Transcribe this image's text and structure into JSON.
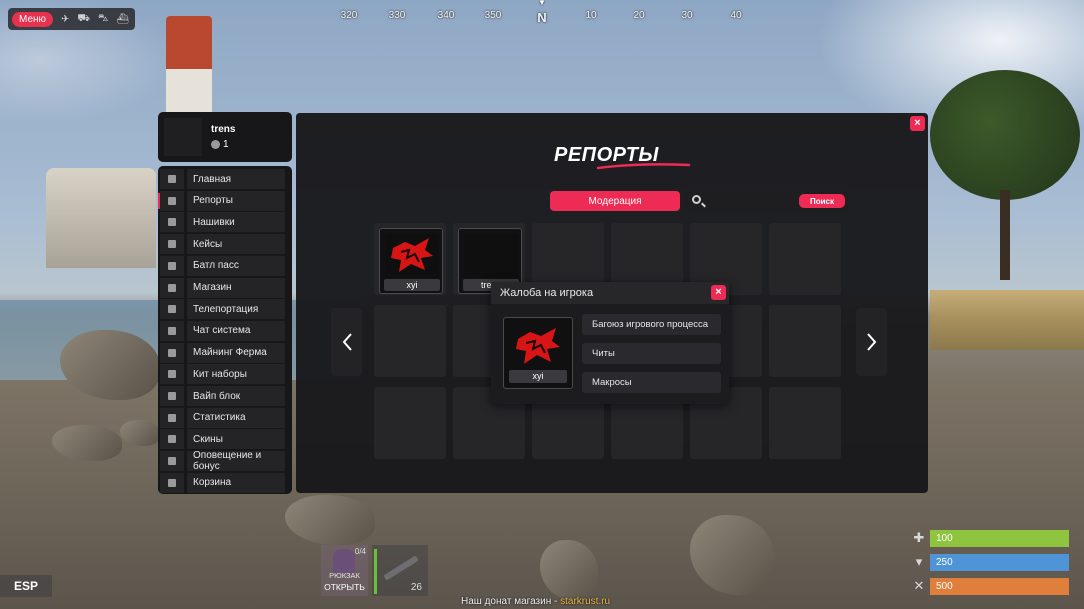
{
  "top_menu": {
    "menu_label": "Меню",
    "icons": [
      "plane-icon",
      "helicopter-icon",
      "tank-icon",
      "boat-icon"
    ]
  },
  "compass": {
    "ticks": [
      "320",
      "330",
      "340",
      "350",
      "N",
      "10",
      "20",
      "30",
      "40"
    ]
  },
  "profile": {
    "name": "trens",
    "coins": "1"
  },
  "sidebar": {
    "items": [
      {
        "label": "Главная",
        "icon": "info-icon"
      },
      {
        "label": "Репорты",
        "icon": "question-icon",
        "active": true
      },
      {
        "label": "Нашивки",
        "icon": "question-icon"
      },
      {
        "label": "Кейсы",
        "icon": "box-icon"
      },
      {
        "label": "Батл пасс",
        "icon": "pass-icon"
      },
      {
        "label": "Магазин",
        "icon": "shop-icon"
      },
      {
        "label": "Телепортация",
        "icon": "teleport-icon"
      },
      {
        "label": "Чат система",
        "icon": "chat-icon"
      },
      {
        "label": "Майнинг Ферма",
        "icon": "mining-icon"
      },
      {
        "label": "Кит наборы",
        "icon": "kit-icon"
      },
      {
        "label": "Вайп блок",
        "icon": "block-icon"
      },
      {
        "label": "Статистика",
        "icon": "stats-icon"
      },
      {
        "label": "Скины",
        "icon": "skin-icon"
      },
      {
        "label": "Оповещение и бонус",
        "icon": "question-icon"
      },
      {
        "label": "Корзина",
        "icon": "question-icon"
      }
    ]
  },
  "reports": {
    "title": "РЕПОРТЫ",
    "moderation_label": "Модерация",
    "search_placeholder": "",
    "search_button": "Поиск",
    "players": [
      {
        "name": "xyi",
        "has_avatar": true
      },
      {
        "name": "trens",
        "has_avatar": false
      }
    ]
  },
  "complaint_popup": {
    "title": "Жалоба на игрока",
    "player_name": "xyi",
    "reasons": [
      "Багоюз игрового процесса",
      "Читы",
      "Макросы"
    ]
  },
  "hud": {
    "esp_label": "ESP",
    "backpack_count": "0/4",
    "backpack_title": "РЮКЗАК",
    "backpack_open": "ОТКРЫТЬ",
    "ammo": "26",
    "donate_prefix": "Наш донат магазин - ",
    "donate_site": "starkrust.ru",
    "health": "100",
    "water": "250",
    "food": "500"
  },
  "colors": {
    "accent": "#ee2b54",
    "health": "#8fc43f",
    "water": "#4f94d6",
    "food": "#e07f3c"
  }
}
